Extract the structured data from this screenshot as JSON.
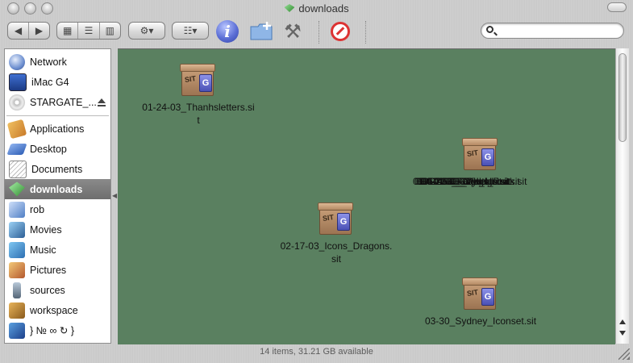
{
  "window": {
    "title": "downloads",
    "status_text": "14 items, 31.21 GB available"
  },
  "toolbar": {
    "back_icon": "arrow-left-icon",
    "forward_icon": "arrow-right-icon",
    "view_icons": [
      "icon-view-icon",
      "list-view-icon",
      "column-view-icon"
    ],
    "action_icon": "gear-icon",
    "arrange_icon": "arrange-icon",
    "info_label": "i",
    "search": {
      "value": "",
      "placeholder": ""
    }
  },
  "sidebar": {
    "devices": [
      {
        "label": "Network",
        "icon": "network-icon"
      },
      {
        "label": "iMac G4",
        "icon": "computer-icon"
      },
      {
        "label": "STARGATE_...",
        "icon": "dvd-icon",
        "ejectable": true
      }
    ],
    "places": [
      {
        "label": "Applications",
        "icon": "applications-icon"
      },
      {
        "label": "Desktop",
        "icon": "desktop-icon"
      },
      {
        "label": "Documents",
        "icon": "documents-icon"
      },
      {
        "label": "downloads",
        "icon": "downloads-icon",
        "selected": true
      },
      {
        "label": "rob",
        "icon": "home-icon"
      },
      {
        "label": "Movies",
        "icon": "movies-icon"
      },
      {
        "label": "Music",
        "icon": "music-icon"
      },
      {
        "label": "Pictures",
        "icon": "pictures-icon"
      },
      {
        "label": "sources",
        "icon": "sources-icon"
      },
      {
        "label": "workspace",
        "icon": "workspace-icon"
      },
      {
        "label": "} № ∞ ↻ }",
        "icon": "book-icon"
      }
    ]
  },
  "files": [
    {
      "name_line1": "01-24-03_Thanhsletters.si",
      "name_line2": "t",
      "icon": "stuffit-archive-icon"
    },
    {
      "name_line1": "02-17-03_Icons_Dragons.",
      "name_line2": "sit",
      "icon": "stuffit-archive-icon"
    },
    {
      "name_line1": "03-30_Sydney_Iconset.sit",
      "name_line2": "",
      "icon": "stuffit-archive-icon"
    }
  ],
  "overlapping_files": {
    "icon": "stuffit-archive-icon",
    "names": [
      "01-04-03_Folders.sit",
      "02-10-03_Cafe_Icons.sit",
      "03-02-03_Gadgets.sit",
      "03-14-03_Crystals.sit",
      "04-01-03_Opticals.sit",
      "04-22-03_Vintage.sit",
      "05-05-03_Pixel_Pack.sit"
    ]
  },
  "theme": {
    "content_bg": "#5a8060",
    "selected_sidebar": "#7b7b7b"
  }
}
